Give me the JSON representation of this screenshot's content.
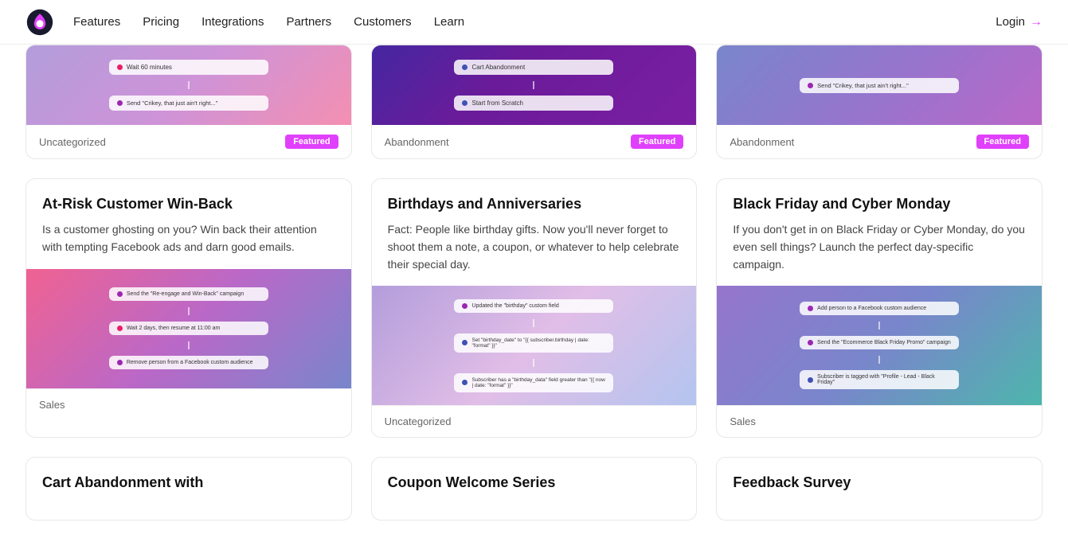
{
  "nav": {
    "logo_alt": "Drip logo",
    "links": [
      {
        "label": "Features",
        "id": "features"
      },
      {
        "label": "Pricing",
        "id": "pricing"
      },
      {
        "label": "Integrations",
        "id": "integrations"
      },
      {
        "label": "Partners",
        "id": "partners"
      },
      {
        "label": "Customers",
        "id": "customers"
      },
      {
        "label": "Learn",
        "id": "learn"
      }
    ],
    "login_label": "Login",
    "login_arrow": "→"
  },
  "top_row": [
    {
      "category": "Uncategorized",
      "featured": true,
      "badge": "Featured",
      "image_class": "img-purple-pink",
      "diagram": [
        {
          "type": "box",
          "dot": "pink",
          "text": "Wait 60 minutes"
        },
        {
          "type": "connector"
        },
        {
          "type": "box",
          "dot": "purple",
          "text": "Send \"Crikey, that just ain't right...\""
        }
      ]
    },
    {
      "category": "Abandonment",
      "featured": true,
      "badge": "Featured",
      "image_class": "img-dark-purple",
      "diagram": [
        {
          "type": "box",
          "dot": "blue",
          "text": "Cart Abandonment"
        },
        {
          "type": "connector"
        },
        {
          "type": "box",
          "dot": "blue",
          "text": "Start from Scratch"
        }
      ]
    },
    {
      "category": "Abandonment",
      "featured": true,
      "badge": "Featured",
      "image_class": "img-blue-purple",
      "diagram": [
        {
          "type": "box",
          "dot": "purple",
          "text": "Send \"Crikey, that just ain't right...\""
        }
      ]
    }
  ],
  "main_cards": [
    {
      "title": "At-Risk Customer Win-Back",
      "description": "Is a customer ghosting on you? Win back their attention with tempting Facebook ads and darn good emails.",
      "category": "Sales",
      "image_class": "img-pink-blue",
      "diagram": [
        {
          "type": "box",
          "dot": "purple",
          "text": "Send the \"Re-engage and Win-Back\" campaign"
        },
        {
          "type": "connector"
        },
        {
          "type": "box",
          "dot": "pink",
          "text": "Wait 2 days, then resume at 11:00 am"
        },
        {
          "type": "connector"
        },
        {
          "type": "box",
          "dot": "purple",
          "text": "Remove person from a Facebook custom audience"
        }
      ]
    },
    {
      "title": "Birthdays and Anniversaries",
      "description": "Fact: People like birthday gifts. Now you'll never forget to shoot them a note, a coupon, or whatever to help celebrate their special day.",
      "category": "Uncategorized",
      "image_class": "img-lavender",
      "diagram": [
        {
          "type": "box",
          "dot": "purple",
          "text": "Updated the \"birthday\" custom field"
        },
        {
          "type": "connector"
        },
        {
          "type": "box",
          "dot": "blue",
          "text": "Set \"birthday_date\" to \"{{ subscriber.birthday | date: \"format\" }}\""
        },
        {
          "type": "connector"
        },
        {
          "type": "box",
          "dot": "blue",
          "text": "Subscriber has a \"birthday_data\" field greater than \"{{ now | date: \"format\" }}\""
        }
      ]
    },
    {
      "title": "Black Friday and Cyber Monday",
      "description": "If you don't get in on Black Friday or Cyber Monday, do you even sell things? Launch the perfect day-specific campaign.",
      "category": "Sales",
      "image_class": "img-soft-purple",
      "diagram": [
        {
          "type": "box",
          "dot": "purple",
          "text": "Add person to a Facebook custom audience"
        },
        {
          "type": "connector"
        },
        {
          "type": "box",
          "dot": "purple",
          "text": "Send the \"Ecommerce Black Friday Promo\" campaign"
        },
        {
          "type": "connector"
        },
        {
          "type": "box",
          "dot": "blue",
          "text": "Subscriber is tagged with \"Profile - Lead - Black Friday\""
        }
      ]
    }
  ],
  "bottom_cards": [
    {
      "title": "Cart Abandonment with",
      "partial": true
    },
    {
      "title": "Coupon Welcome Series",
      "partial": true
    },
    {
      "title": "Feedback Survey",
      "partial": true
    }
  ]
}
